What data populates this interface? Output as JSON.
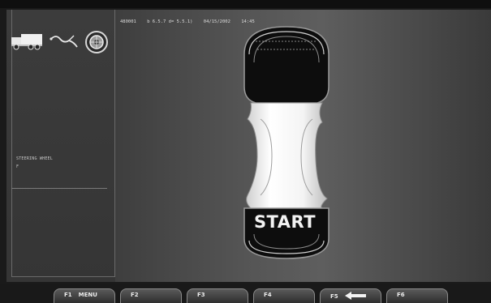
{
  "status": {
    "machine_id": "480001",
    "dimensions": "b 6.5.7 d= 5.5.1)",
    "date": "04/15/2002",
    "time": "14:45"
  },
  "left_panel": {
    "label": "STEERING WHEEL",
    "value": "F"
  },
  "icons": [
    "truck-icon",
    "cable-icon",
    "wheel-icon"
  ],
  "main": {
    "start_label": "START"
  },
  "function_keys": [
    {
      "key": "F1",
      "label": "MENU"
    },
    {
      "key": "F2",
      "label": ""
    },
    {
      "key": "F3",
      "label": ""
    },
    {
      "key": "F4",
      "label": ""
    },
    {
      "key": "F5",
      "label": "",
      "icon": "arrow-left-icon"
    },
    {
      "key": "F6",
      "label": ""
    }
  ],
  "colors": {
    "background": "#1a1a1a",
    "panel": "#3a3a3a",
    "main": "#555555",
    "text": "#f2f2f2"
  }
}
